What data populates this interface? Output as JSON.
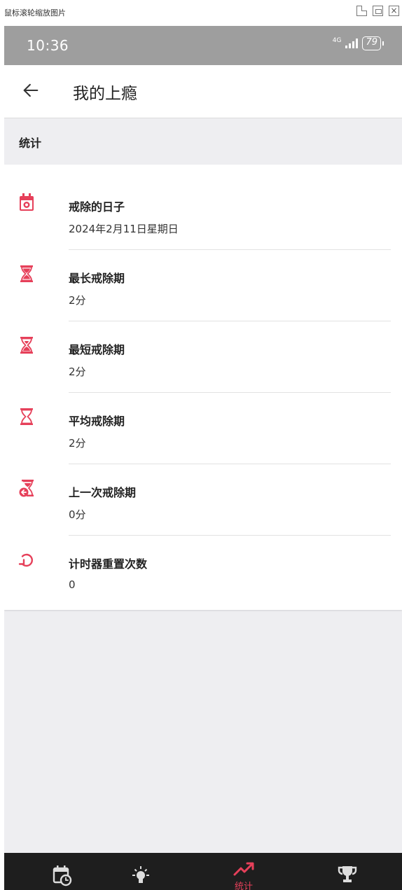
{
  "viewer": {
    "title": "鼠标滚轮缩放图片",
    "close_glyph": "×"
  },
  "status_bar": {
    "time": "10:36",
    "network": "4G",
    "battery": "79"
  },
  "app_bar": {
    "title": "我的上瘾",
    "back_icon": "arrow-left-icon"
  },
  "section": {
    "title": "统计"
  },
  "accent_color": "#e6405a",
  "stats": [
    {
      "label": "戒除的日子",
      "value": "2024年2月11日星期日",
      "icon": "calendar-icon"
    },
    {
      "label": "最长戒除期",
      "value": "2分",
      "icon": "hourglass-full-icon"
    },
    {
      "label": "最短戒除期",
      "value": "2分",
      "icon": "hourglass-bottom-icon"
    },
    {
      "label": "平均戒除期",
      "value": "2分",
      "icon": "hourglass-empty-icon"
    },
    {
      "label": "上一次戒除期",
      "value": "0分",
      "icon": "hourglass-back-icon"
    },
    {
      "label": "计时器重置次数",
      "value": "0",
      "icon": "reset-icon"
    }
  ],
  "bottom_nav": {
    "items": [
      {
        "icon": "calendar-clock-icon"
      },
      {
        "icon": "lightbulb-icon"
      },
      {
        "icon": "trending-up-icon",
        "label": "统计",
        "active": true
      },
      {
        "icon": "trophy-icon"
      }
    ]
  }
}
